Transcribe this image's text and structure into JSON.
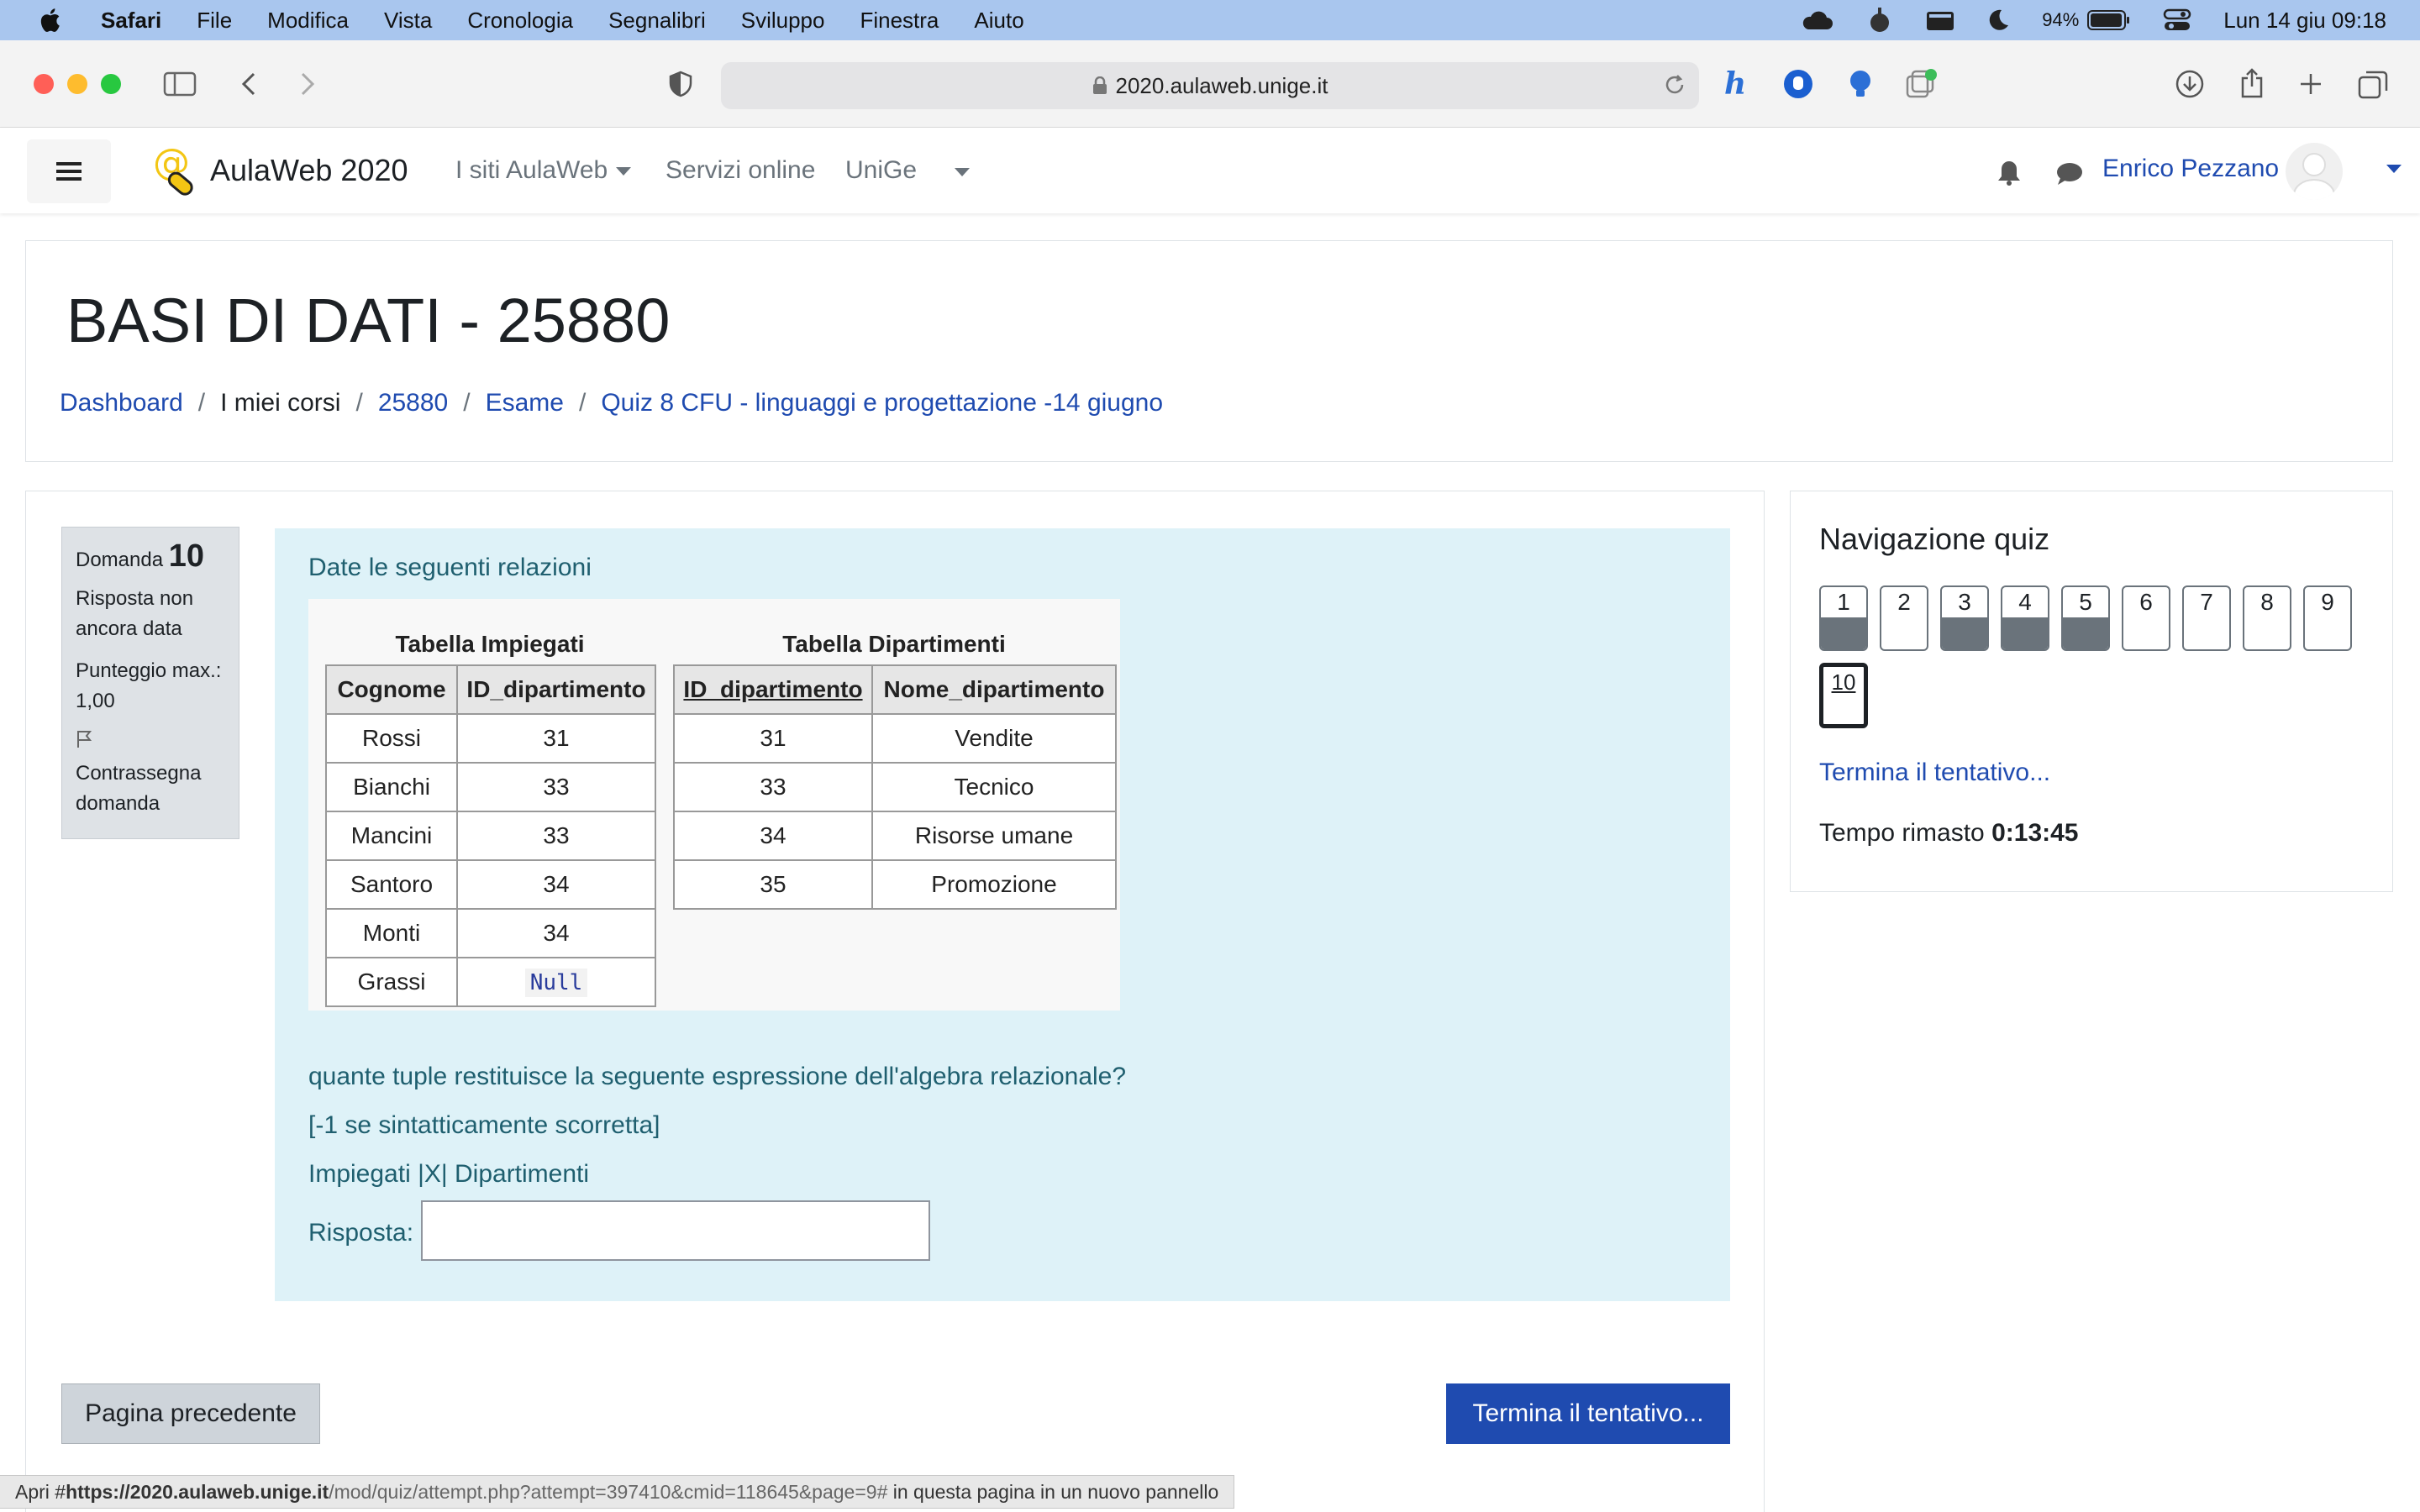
{
  "menubar": {
    "app": "Safari",
    "items": [
      "File",
      "Modifica",
      "Vista",
      "Cronologia",
      "Segnalibri",
      "Sviluppo",
      "Finestra",
      "Aiuto"
    ],
    "battery": "94%",
    "datetime": "Lun 14 giu  09:18"
  },
  "browser": {
    "url": "2020.aulaweb.unige.it",
    "status_prefix": "Apri #",
    "status_url_bold": "https://2020.aulaweb.unige.it",
    "status_url_rest": "/mod/quiz/attempt.php?attempt=397410&cmid=118645&page=9#",
    "status_suffix": " in questa pagina in un nuovo pannello"
  },
  "navbar": {
    "site_name": "AulaWeb 2020",
    "links": [
      "I siti AulaWeb",
      "Servizi online",
      "UniGe"
    ],
    "user_name": "Enrico Pezzano"
  },
  "header": {
    "title": "BASI DI DATI - 25880",
    "breadcrumb": [
      "Dashboard",
      "I miei corsi",
      "25880",
      "Esame",
      "Quiz 8 CFU - linguaggi e progettazione -14 giugno"
    ]
  },
  "question_info": {
    "label": "Domanda",
    "number": "10",
    "status": "Risposta non ancora data",
    "grade": "Punteggio max.: 1,00",
    "flag": "Contrassegna domanda"
  },
  "question": {
    "intro": "Date le seguenti relazioni",
    "table1": {
      "title": "Tabella Impiegati",
      "headers": [
        "Cognome",
        "ID_dipartimento"
      ],
      "rows": [
        [
          "Rossi",
          "31"
        ],
        [
          "Bianchi",
          "33"
        ],
        [
          "Mancini",
          "33"
        ],
        [
          "Santoro",
          "34"
        ],
        [
          "Monti",
          "34"
        ],
        [
          "Grassi",
          "Null"
        ]
      ]
    },
    "table2": {
      "title": "Tabella Dipartimenti",
      "headers": [
        "ID_dipartimento",
        "Nome_dipartimento"
      ],
      "rows": [
        [
          "31",
          "Vendite"
        ],
        [
          "33",
          "Tecnico"
        ],
        [
          "34",
          "Risorse umane"
        ],
        [
          "35",
          "Promozione"
        ]
      ]
    },
    "line1": "quante tuple restituisce la seguente espressione dell'algebra relazionale?",
    "line2": "[-1 se sintatticamente scorretta]",
    "line3": "Impiegati |X| Dipartimenti",
    "answer_label": "Risposta:",
    "answer_value": ""
  },
  "buttons": {
    "previous": "Pagina precedente",
    "finish": "Termina il tentativo..."
  },
  "quiz_nav": {
    "title": "Navigazione quiz",
    "questions": [
      {
        "n": "1",
        "answered": true
      },
      {
        "n": "2",
        "answered": false
      },
      {
        "n": "3",
        "answered": true
      },
      {
        "n": "4",
        "answered": true
      },
      {
        "n": "5",
        "answered": true
      },
      {
        "n": "6",
        "answered": false
      },
      {
        "n": "7",
        "answered": false
      },
      {
        "n": "8",
        "answered": false
      },
      {
        "n": "9",
        "answered": false
      },
      {
        "n": "10",
        "answered": false,
        "current": true
      }
    ],
    "finish_link": "Termina il tentativo...",
    "time_label": "Tempo rimasto",
    "time_value": "0:13:45"
  },
  "colors": {
    "accent": "#1f4bb0",
    "question_bg": "#def2f8",
    "menubar_bg": "#a9c6ee"
  }
}
